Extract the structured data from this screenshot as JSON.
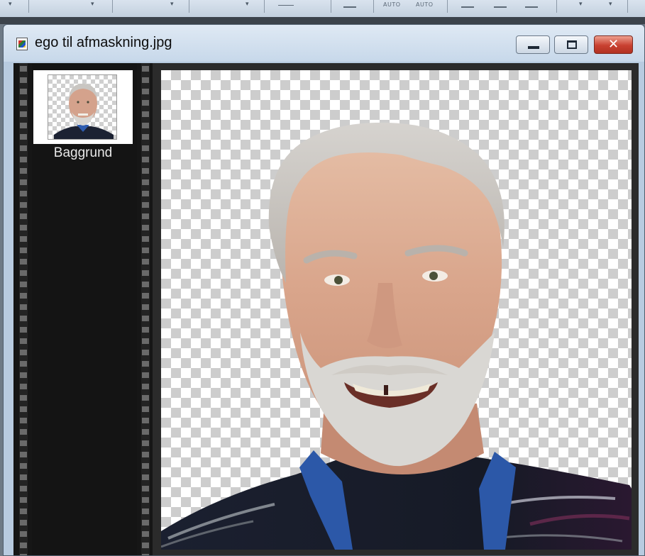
{
  "document": {
    "title": "ego til afmaskning.jpg",
    "icon": "image-file-icon"
  },
  "window_controls": {
    "minimize": "minimize-icon",
    "maximize": "restore-icon",
    "close": "close-icon",
    "close_glyph": "✕"
  },
  "toolbar": {
    "auto_label_1": "AUTO",
    "auto_label_2": "AUTO"
  },
  "layers": [
    {
      "name": "Baggrund"
    }
  ],
  "colors": {
    "titlebar": "#c7d8ea",
    "close_button": "#c84030",
    "filmstrip": "#141414",
    "checker_light": "#ffffff",
    "checker_dark": "#cdcdcd"
  }
}
